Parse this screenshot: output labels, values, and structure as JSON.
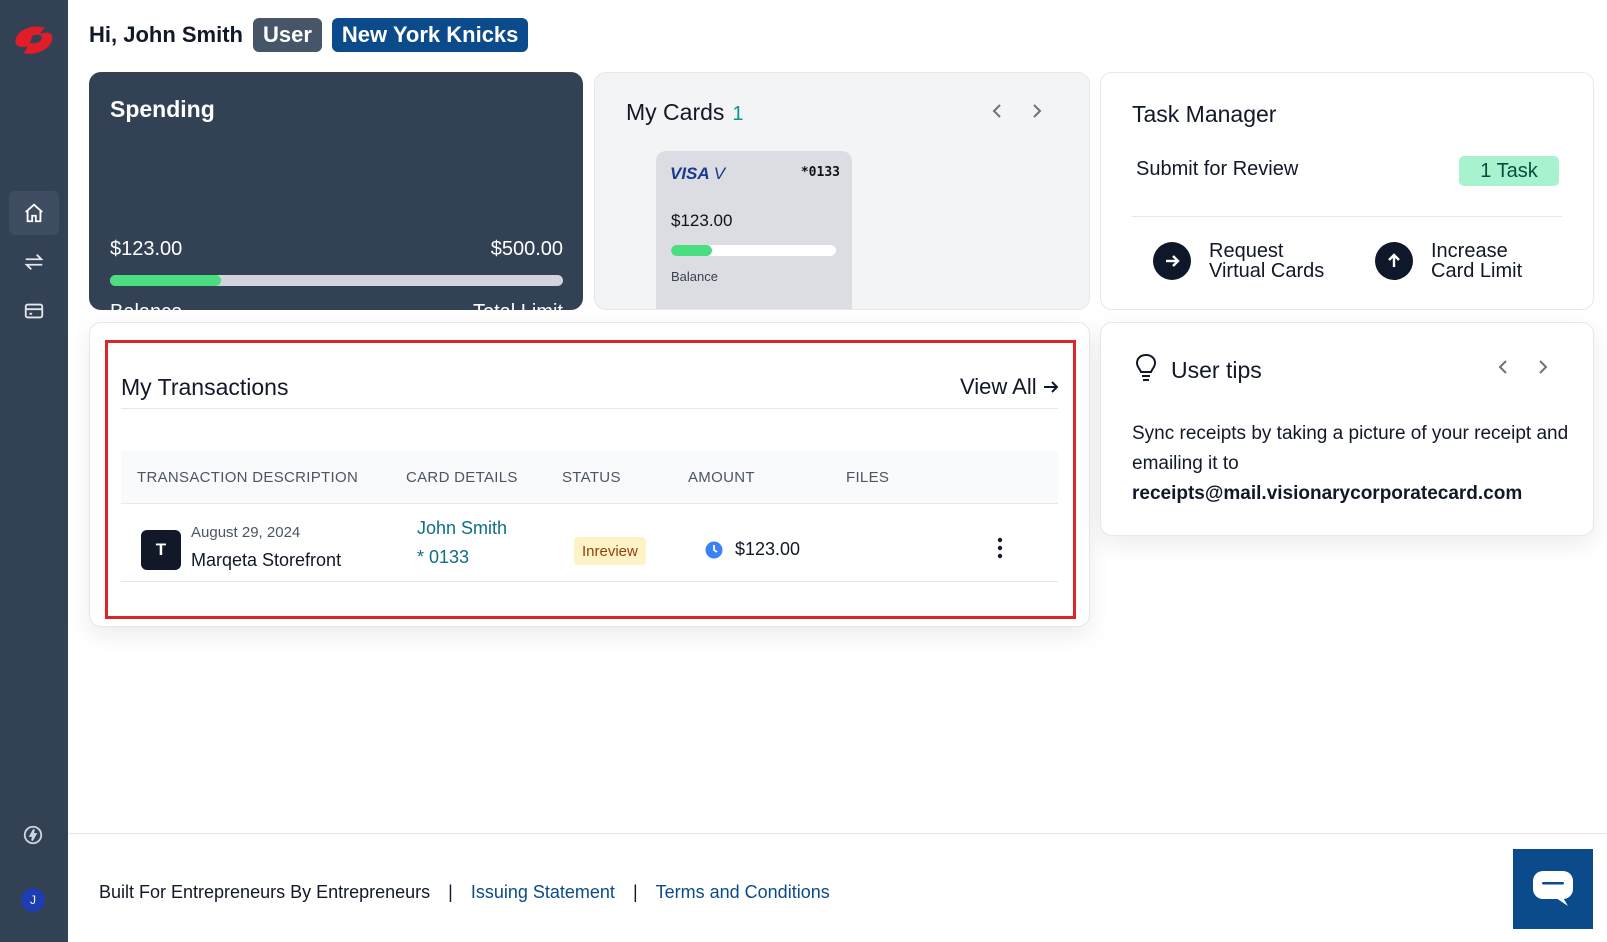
{
  "header": {
    "greeting": "Hi, John Smith",
    "role_badge": "User",
    "team_badge": "New York Knicks"
  },
  "spending": {
    "title": "Spending",
    "balance_value": "$123.00",
    "limit_value": "$500.00",
    "balance_label": "Balance",
    "limit_label": "Total Limit",
    "progress_fraction": 0.246
  },
  "my_cards": {
    "title": "My Cards",
    "count": "1",
    "card": {
      "network": "VISA",
      "last4": "*0133",
      "balance": "$123.00",
      "balance_label": "Balance",
      "progress_fraction": 0.246
    }
  },
  "task_manager": {
    "title": "Task Manager",
    "task_label": "Submit for Review",
    "task_badge": "1 Task",
    "actions": [
      {
        "line1": "Request",
        "line2": "Virtual Cards",
        "icon": "arrow-right-icon"
      },
      {
        "line1": "Increase",
        "line2": "Card Limit",
        "icon": "arrow-up-icon"
      }
    ]
  },
  "transactions": {
    "title": "My Transactions",
    "view_all": "View All",
    "columns": [
      "TRANSACTION DESCRIPTION",
      "CARD DETAILS",
      "STATUS",
      "AMOUNT",
      "FILES"
    ],
    "rows": [
      {
        "icon_letter": "T",
        "date": "August 29, 2024",
        "merchant": "Marqeta Storefront",
        "card_holder": "John Smith",
        "card_last4": "* 0133",
        "status": "Inreview",
        "amount": "$123.00"
      }
    ]
  },
  "user_tips": {
    "title": "User tips",
    "text": "Sync receipts by taking a picture of your receipt and emailing it to",
    "email": "receipts@mail.visionarycorporatecard.com"
  },
  "footer": {
    "tagline": "Built For Entrepreneurs By Entrepreneurs",
    "separator": "|",
    "issuing_statement": "Issuing Statement",
    "terms": "Terms and Conditions"
  },
  "sidebar": {
    "avatar_initial": "J",
    "items": [
      "home-icon",
      "transfer-icon",
      "card-icon"
    ]
  },
  "colors": {
    "sidebar": "#334155",
    "brand_blue": "#0b4a8b",
    "progress_green": "#4ade80",
    "highlight_red": "#dc2626"
  }
}
